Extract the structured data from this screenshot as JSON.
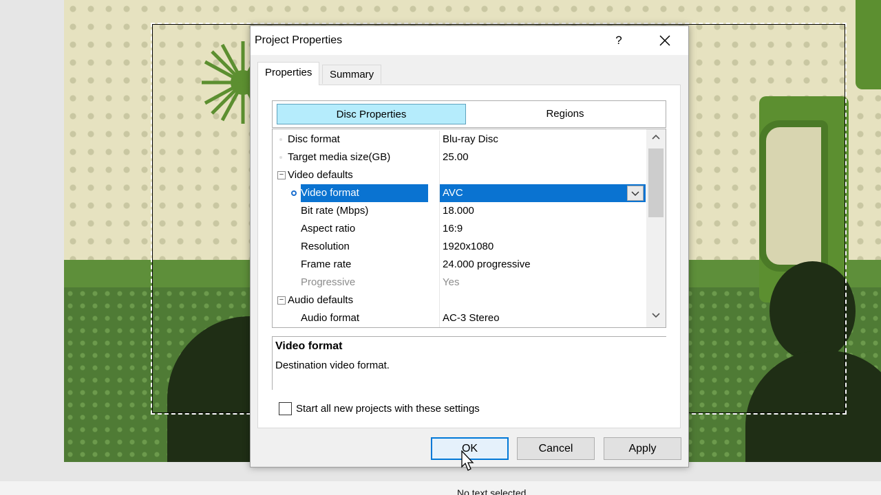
{
  "status_bar": {
    "text": "No text selected"
  },
  "dialog": {
    "title": "Project Properties",
    "help_label": "?",
    "tabs": [
      {
        "label": "Properties",
        "active": true
      },
      {
        "label": "Summary",
        "active": false
      }
    ],
    "subtabs": [
      {
        "label": "Disc Properties",
        "active": true
      },
      {
        "label": "Regions",
        "active": false
      }
    ],
    "properties": [
      {
        "name": "Disc format",
        "value": "Blu-ray Disc",
        "level": 0,
        "kind": "item"
      },
      {
        "name": "Target media size(GB)",
        "value": "25.00",
        "level": 0,
        "kind": "item"
      },
      {
        "name": "Video defaults",
        "value": "",
        "level": 0,
        "kind": "group",
        "expander": "−"
      },
      {
        "name": "Video format",
        "value": "AVC",
        "level": 1,
        "kind": "item",
        "selected": true
      },
      {
        "name": "Bit rate (Mbps)",
        "value": "18.000",
        "level": 1,
        "kind": "item"
      },
      {
        "name": "Aspect ratio",
        "value": "16:9",
        "level": 1,
        "kind": "item"
      },
      {
        "name": "Resolution",
        "value": "1920x1080",
        "level": 1,
        "kind": "item"
      },
      {
        "name": "Frame rate",
        "value": "24.000 progressive",
        "level": 1,
        "kind": "item"
      },
      {
        "name": "Progressive",
        "value": "Yes",
        "level": 1,
        "kind": "item",
        "disabled": true
      },
      {
        "name": "Audio defaults",
        "value": "",
        "level": 0,
        "kind": "group",
        "expander": "−"
      },
      {
        "name": "Audio format",
        "value": "AC-3 Stereo",
        "level": 1,
        "kind": "item"
      }
    ],
    "description": {
      "title": "Video format",
      "text": "Destination video format."
    },
    "checkbox": {
      "label": "Start all new projects with these settings",
      "checked": false
    },
    "buttons": {
      "ok": "OK",
      "cancel": "Cancel",
      "apply": "Apply"
    }
  },
  "icons": {
    "close": "close-icon",
    "dropdown": "chevron-down-icon",
    "scroll_up": "chevron-up-icon",
    "scroll_down": "chevron-down-icon",
    "cursor": "mouse-pointer-icon"
  },
  "colors": {
    "selection": "#0a73d1",
    "active_subtab": "#b5ecfc",
    "default_button_border": "#0078d7"
  }
}
